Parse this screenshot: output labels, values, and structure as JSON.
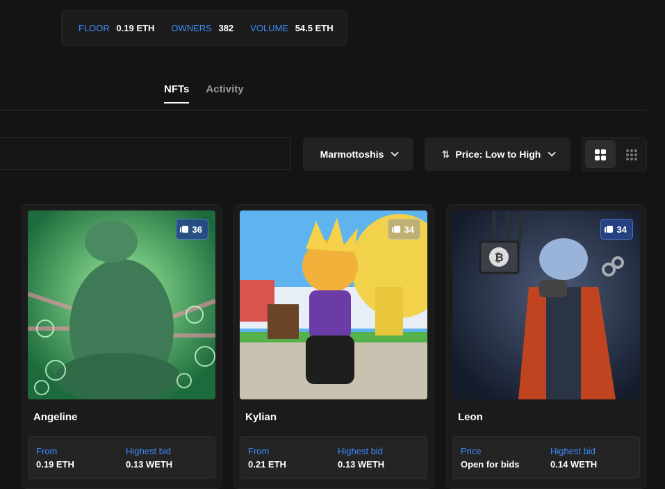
{
  "stats": [
    {
      "label": "FLOOR",
      "value": "0.19 ETH"
    },
    {
      "label": "OWNERS",
      "value": "382"
    },
    {
      "label": "VOLUME",
      "value": "54.5 ETH"
    }
  ],
  "tabs": [
    {
      "label": "NFTs",
      "active": true
    },
    {
      "label": "Activity",
      "active": false
    }
  ],
  "search": {
    "placeholder": ""
  },
  "filters": {
    "collection": "Marmottoshis",
    "sort": "Price: Low to High"
  },
  "cards": [
    {
      "name": "Angeline",
      "editions": "36",
      "price_label": "From",
      "price": "0.19 ETH",
      "bid_label": "Highest bid",
      "bid": "0.13 WETH"
    },
    {
      "name": "Kylian",
      "editions": "34",
      "price_label": "From",
      "price": "0.21 ETH",
      "bid_label": "Highest bid",
      "bid": "0.13 WETH"
    },
    {
      "name": "Leon",
      "editions": "34",
      "price_label": "Price",
      "price": "Open for bids",
      "bid_label": "Highest bid",
      "bid": "0.14 WETH"
    }
  ],
  "colors": {
    "accent": "#3d8bfd",
    "background": "#141414",
    "card": "#1b1b1b"
  }
}
